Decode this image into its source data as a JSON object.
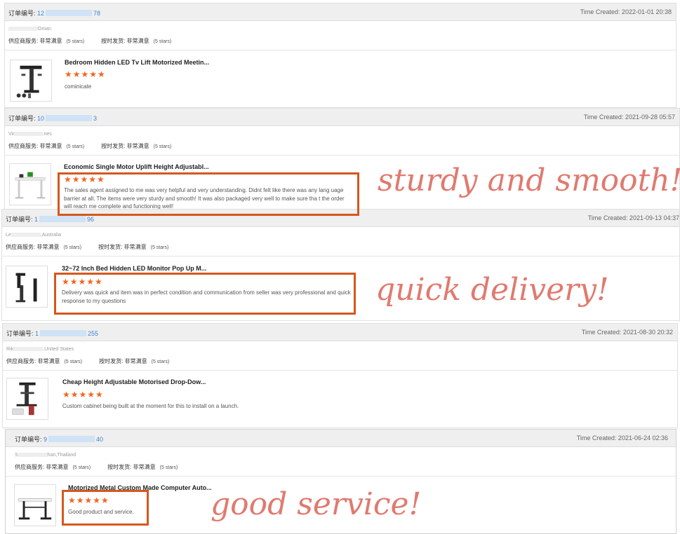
{
  "labels": {
    "order_no": "订单编号:",
    "supplier_service": "供应商服务:",
    "ship_on_time": "按时发货:",
    "very_satisfied": "非常满意",
    "five_stars": "(5 stars)",
    "star_glyphs": "★★★★★"
  },
  "orders": [
    {
      "order_prefix": "12",
      "order_suffix": "78",
      "time_created": "Time Created: 2022-01-01 20:38",
      "buyer_prefix": "",
      "buyer_suffix": "Oman",
      "product_title": "Bedroom Hidden LED Tv Lift Motorized Meetin...",
      "rating_stars": 5,
      "comment": "cominicate"
    },
    {
      "order_prefix": "10",
      "order_suffix": "3",
      "time_created": "Time Created: 2021-09-28 05:57",
      "buyer_prefix": "Vir",
      "buyer_suffix": "nes",
      "product_title": "Economic Single Motor Uplift Height Adjustabl...",
      "rating_stars": 5,
      "comment": "The sales agent assigned to me was very helpful and very understanding. Didnt felt like there was any lang uage barrier at all. The items were very sturdy and smooth! It was also packaged very well to make sure tha t the order will reach me complete and functioning well!"
    },
    {
      "order_prefix": "1",
      "order_suffix": "96",
      "time_created": "Time Created: 2021-09-13 04:37",
      "buyer_prefix": "Le",
      "buyer_suffix": ",Australia",
      "product_title": "32~72 Inch Bed Hidden LED Monitor Pop Up M...",
      "rating_stars": 5,
      "comment": "Delivery was quick and item was in perfect condition and communication from seller was very professional and quick response to my questions"
    },
    {
      "order_prefix": "1",
      "order_suffix": "255",
      "time_created": "Time Created: 2021-08-30 20:32",
      "buyer_prefix": "Rik",
      "buyer_suffix": ",United States",
      "product_title": "Cheap Height Adjustable Motorised Drop-Dow...",
      "rating_stars": 5,
      "comment": "Custom cabinet being built at the moment for this to install on a launch."
    },
    {
      "order_prefix": "9",
      "order_suffix": "40",
      "time_created": "Time Created: 2021-06-24 02:36",
      "buyer_prefix": "S",
      "buyer_suffix": "han,Thailand",
      "product_title": "Motorized Metal Custom Made Computer Auto...",
      "rating_stars": 5,
      "comment": "Good product and service."
    }
  ],
  "annotations": {
    "sturdy": "sturdy and smooth!",
    "quick": "quick delivery!",
    "service": "good service!"
  },
  "colors": {
    "star": "#f26522",
    "highlight_box": "#d4581e",
    "annotation_text": "#e07a70",
    "order_number": "#3a86d8"
  }
}
